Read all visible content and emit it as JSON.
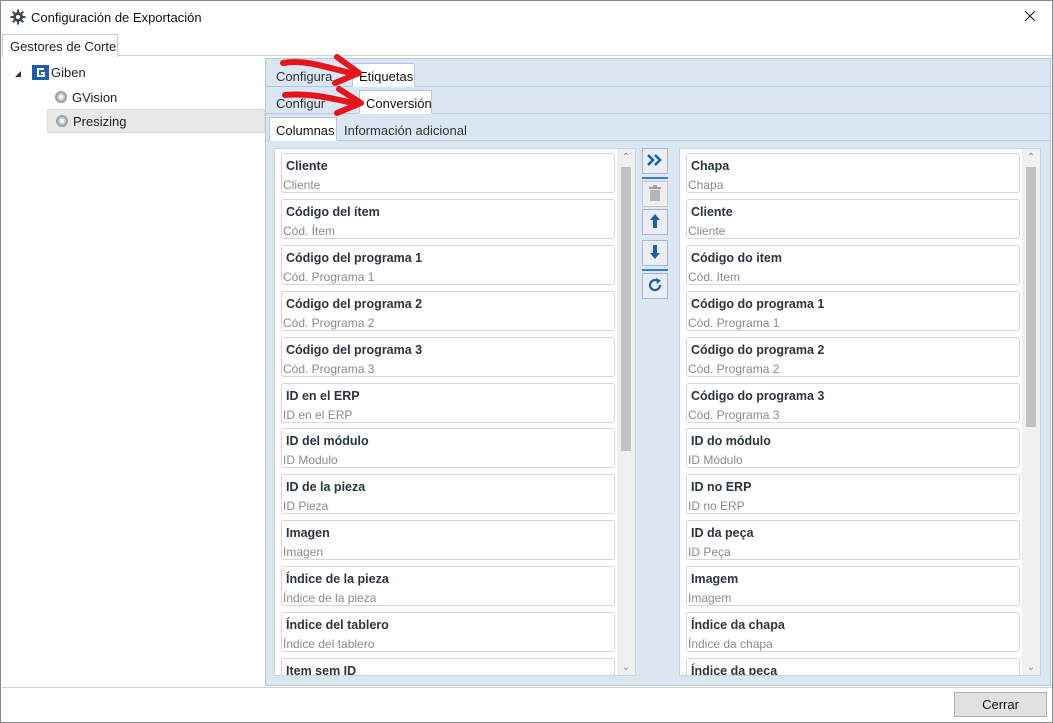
{
  "window": {
    "title": "Configuración de Exportación"
  },
  "outer_tab": "Gestores de Corte",
  "tree": {
    "root": "Giben",
    "children": [
      "GVision",
      "Presizing"
    ]
  },
  "tabs_level1": {
    "partial": "Configura",
    "active": "Etiquetas"
  },
  "tabs_level2": {
    "partial": "Configur",
    "active": "Conversión"
  },
  "tabs_level3": {
    "active": "Columnas",
    "other": "Información adicional"
  },
  "left_list": [
    {
      "title": "Cliente",
      "sub": "Cliente"
    },
    {
      "title": "Código del ítem",
      "sub": "Cód. Ítem"
    },
    {
      "title": "Código del programa 1",
      "sub": "Cód. Programa 1"
    },
    {
      "title": "Código del programa 2",
      "sub": "Cód. Programa 2"
    },
    {
      "title": "Código del programa 3",
      "sub": "Cód. Programa 3"
    },
    {
      "title": "ID en el ERP",
      "sub": "ID en el ERP"
    },
    {
      "title": "ID del módulo",
      "sub": "ID Modulo"
    },
    {
      "title": "ID de la pieza",
      "sub": "ID Pieza"
    },
    {
      "title": "Imagen",
      "sub": "Imagen"
    },
    {
      "title": "Índice de la pieza",
      "sub": "Índice de la pieza"
    },
    {
      "title": "Índice del tablero",
      "sub": "Índice del tablero"
    },
    {
      "title": "Item sem ID",
      "sub": ""
    }
  ],
  "right_list": [
    {
      "title": "Chapa",
      "sub": "Chapa"
    },
    {
      "title": "Cliente",
      "sub": "Cliente"
    },
    {
      "title": "Código do item",
      "sub": "Cód. Item"
    },
    {
      "title": "Código do programa 1",
      "sub": "Cód. Programa 1"
    },
    {
      "title": "Código do programa 2",
      "sub": "Cód. Programa 2"
    },
    {
      "title": "Código do programa 3",
      "sub": "Cód. Programa 3"
    },
    {
      "title": "ID do módulo",
      "sub": "ID Módulo"
    },
    {
      "title": "ID no ERP",
      "sub": "ID no ERP"
    },
    {
      "title": "ID da peça",
      "sub": "ID Peça"
    },
    {
      "title": "Imagem",
      "sub": "Imagem"
    },
    {
      "title": "Índice da chapa",
      "sub": "Índice da chapa"
    },
    {
      "title": "Índice da peça",
      "sub": ""
    }
  ],
  "buttons": {
    "close": "Cerrar"
  },
  "colors": {
    "panel_bg": "#dbe6f3",
    "accent": "#1f5fa8",
    "annotation": "#e8131b"
  }
}
